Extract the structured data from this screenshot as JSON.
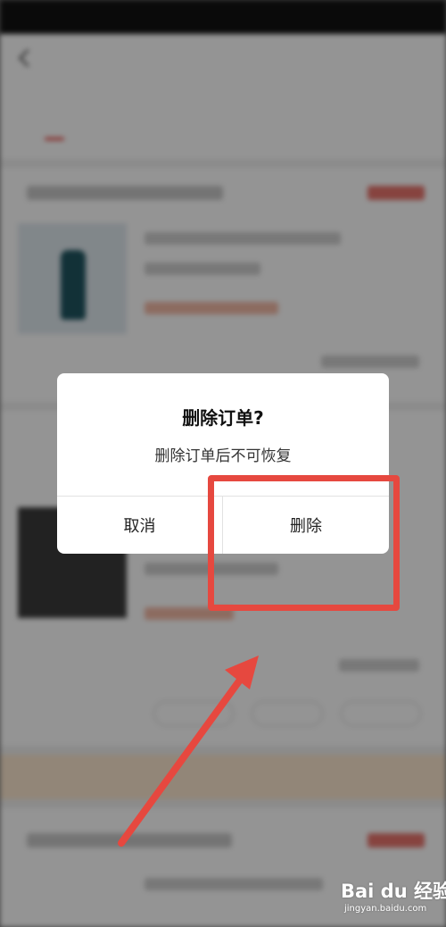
{
  "dialog": {
    "title": "删除订单?",
    "message": "删除订单后不可恢复",
    "cancel_label": "取消",
    "delete_label": "删除"
  },
  "annotation": {
    "color": "#e6483f"
  },
  "watermark": {
    "logo_text": "Bai du 经验",
    "url": "jingyan.baidu.com"
  },
  "colors": {
    "dialog_bg": "#ffffff",
    "overlay": "rgba(0,0,0,0.42)",
    "accent_red": "#e5322d"
  }
}
